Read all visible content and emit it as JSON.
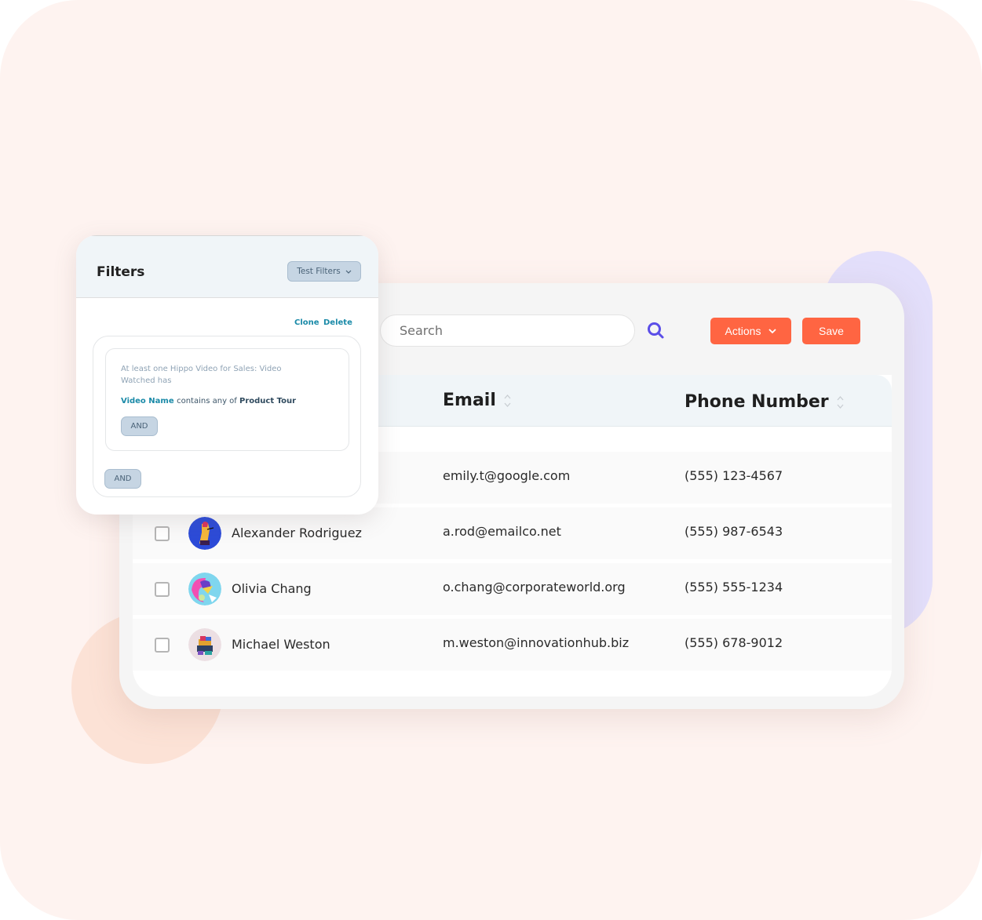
{
  "colors": {
    "accent_orange": "#ff6542",
    "search_icon": "#5b4ee8",
    "link_teal": "#1a8aa8",
    "chip_bg": "#c6d5e3",
    "frame_bg": "#fef3f0",
    "deco_purple": "#e3dffb",
    "deco_peach": "#fce2d6"
  },
  "toolbar": {
    "search_placeholder": "Search",
    "search_value": "",
    "search_icon": "search-icon",
    "actions_label": "Actions",
    "actions_icon": "chevron-down-icon",
    "save_label": "Save"
  },
  "table": {
    "columns": [
      {
        "label": "Email",
        "sort_icon": "sort-icon"
      },
      {
        "label": "Phone Number",
        "sort_icon": "sort-icon"
      }
    ],
    "rows": [
      {
        "name": "",
        "email": "emily.t@google.com",
        "phone": "(555) 123-4567",
        "avatar": "avatar-hidden"
      },
      {
        "name": "Alexander Rodriguez",
        "email": "a.rod@emailco.net",
        "phone": "(555) 987-6543",
        "avatar": "avatar-blue-illustration"
      },
      {
        "name": "Olivia Chang",
        "email": "o.chang@corporateworld.org",
        "phone": "(555) 555-1234",
        "avatar": "avatar-pink-illustration"
      },
      {
        "name": "Michael Weston",
        "email": "m.weston@innovationhub.biz",
        "phone": "(555) 678-9012",
        "avatar": "avatar-collage-illustration"
      }
    ]
  },
  "filters": {
    "title": "Filters",
    "test_filters_label": "Test Filters",
    "clone_label": "Clone",
    "delete_label": "Delete",
    "condition_description": "At least one Hippo Video for Sales: Video Watched has",
    "rule": {
      "field": "Video Name",
      "operator": "contains any of",
      "value": "Product Tour"
    },
    "inner_and_label": "AND",
    "outer_and_label": "AND"
  }
}
